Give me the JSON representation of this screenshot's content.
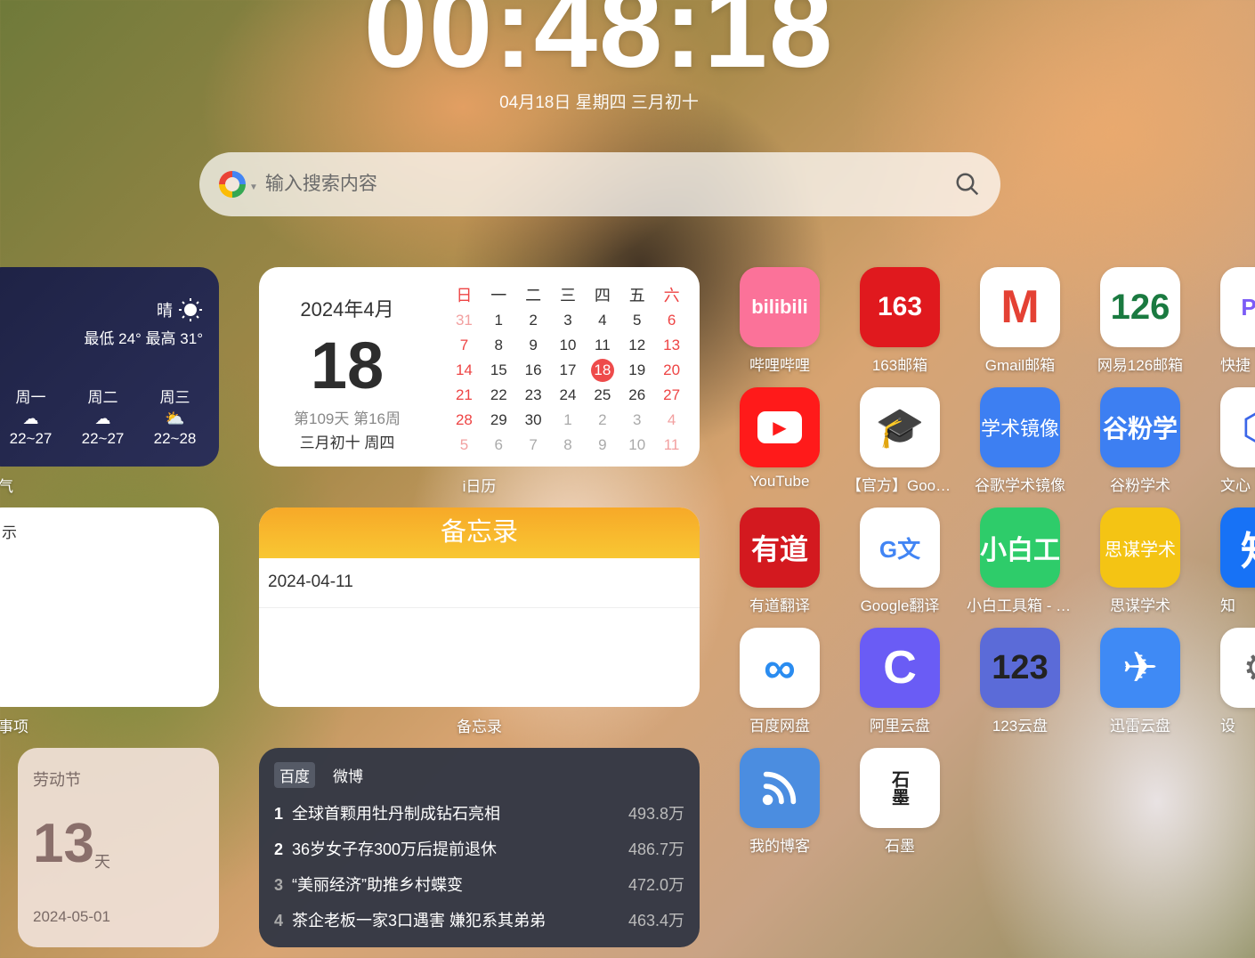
{
  "clock": {
    "time": "00:48:18",
    "date": "04月18日 星期四 三月初十"
  },
  "search": {
    "placeholder": "输入搜索内容"
  },
  "weather": {
    "condition": "晴",
    "range": "最低 24° 最高 31°",
    "forecast": [
      {
        "day": "周一",
        "icon": "rain-icon",
        "temp": "22~27"
      },
      {
        "day": "周二",
        "icon": "rain-icon",
        "temp": "22~27"
      },
      {
        "day": "周三",
        "icon": "partly-cloudy-icon",
        "temp": "22~28"
      }
    ],
    "caption": "气"
  },
  "calendar": {
    "year_month": "2024年4月",
    "day": "18",
    "info": "第109天 第16周",
    "lunar": "三月初十 周四",
    "headers": [
      "日",
      "一",
      "二",
      "三",
      "四",
      "五",
      "六"
    ],
    "rows": [
      [
        "31",
        "1",
        "2",
        "3",
        "4",
        "5",
        "6"
      ],
      [
        "7",
        "8",
        "9",
        "10",
        "11",
        "12",
        "13"
      ],
      [
        "14",
        "15",
        "16",
        "17",
        "18",
        "19",
        "20"
      ],
      [
        "21",
        "22",
        "23",
        "24",
        "25",
        "26",
        "27"
      ],
      [
        "28",
        "29",
        "30",
        "1",
        "2",
        "3",
        "4"
      ],
      [
        "5",
        "6",
        "7",
        "8",
        "9",
        "10",
        "11"
      ]
    ],
    "today": "18",
    "caption": "i日历"
  },
  "todo": {
    "title": "示",
    "caption": "事项"
  },
  "memo": {
    "title": "备忘录",
    "entry": "2024-04-11",
    "caption": "备忘录"
  },
  "holiday": {
    "name": "劳动节",
    "days": "13",
    "unit": "天",
    "date": "2024-05-01"
  },
  "hot": {
    "tabs": [
      "百度",
      "微博"
    ],
    "items": [
      {
        "rank": "1",
        "title": "全球首颗用牡丹制成钻石亮相",
        "value": "493.8万"
      },
      {
        "rank": "2",
        "title": "36岁女子存300万后提前退休",
        "value": "486.7万"
      },
      {
        "rank": "3",
        "title": "“美丽经济”助推乡村蝶变",
        "value": "472.0万"
      },
      {
        "rank": "4",
        "title": "茶企老板一家3口遇害 嫌犯系其弟弟",
        "value": "463.4万"
      }
    ]
  },
  "apps": [
    {
      "label": "哔哩哔哩",
      "glyph": "bilibili",
      "icon": "bilibili-icon",
      "bg": "#fb7299"
    },
    {
      "label": "163邮箱",
      "glyph": "163",
      "icon": "mail-163-icon",
      "bg": "#e0191e"
    },
    {
      "label": "Gmail邮箱",
      "glyph": "M",
      "icon": "gmail-icon",
      "bg": "#ffffff"
    },
    {
      "label": "网易126邮箱",
      "glyph": "126",
      "icon": "mail-126-icon",
      "bg": "#ffffff"
    },
    {
      "label": "快捷",
      "glyph": "Pro",
      "icon": "pro-icon",
      "bg": "#ffffff"
    },
    {
      "label": "YouTube",
      "glyph": "▶",
      "icon": "youtube-icon",
      "bg": "#ff1a1a"
    },
    {
      "label": "【官方】Google学术",
      "glyph": "🎓",
      "icon": "google-scholar-icon",
      "bg": "#ffffff"
    },
    {
      "label": "谷歌学术镜像",
      "glyph": "学术镜像",
      "icon": "scholar-mirror-icon",
      "bg": "#3d7ff2"
    },
    {
      "label": "谷粉学术",
      "glyph": "谷粉学",
      "icon": "gufen-icon",
      "bg": "#3d7ff2"
    },
    {
      "label": "文心",
      "glyph": "⬡",
      "icon": "wenxin-icon",
      "bg": "#ffffff"
    },
    {
      "label": "有道翻译",
      "glyph": "有道",
      "icon": "youdao-icon",
      "bg": "#d3191f"
    },
    {
      "label": "Google翻译",
      "glyph": "G文",
      "icon": "google-translate-icon",
      "bg": "#ffffff"
    },
    {
      "label": "小白工具箱 - 小白工具网",
      "glyph": "小白工",
      "icon": "xiaobai-icon",
      "bg": "#2ecc6a"
    },
    {
      "label": "思谋学术",
      "glyph": "思谋学术",
      "icon": "simou-icon",
      "bg": "#f4c414"
    },
    {
      "label": "知",
      "glyph": "知",
      "icon": "zhihu-icon",
      "bg": "#1772f6"
    },
    {
      "label": "百度网盘",
      "glyph": "∞",
      "icon": "baidu-pan-icon",
      "bg": "#ffffff"
    },
    {
      "label": "阿里云盘",
      "glyph": "C",
      "icon": "aliyun-pan-icon",
      "bg": "#6a5cf5"
    },
    {
      "label": "123云盘",
      "glyph": "123",
      "icon": "pan-123-icon",
      "bg": "#5b6bd8"
    },
    {
      "label": "迅雷云盘",
      "glyph": "✈",
      "icon": "xunlei-icon",
      "bg": "#3f8af5"
    },
    {
      "label": "设",
      "glyph": "⚙",
      "icon": "settings-icon",
      "bg": "#ffffff"
    },
    {
      "label": "我的博客",
      "glyph": "rss",
      "icon": "rss-icon",
      "bg": "#4b8de0"
    },
    {
      "label": "石墨",
      "glyph": "石墨",
      "icon": "shimo-icon",
      "bg": "#ffffff"
    }
  ]
}
